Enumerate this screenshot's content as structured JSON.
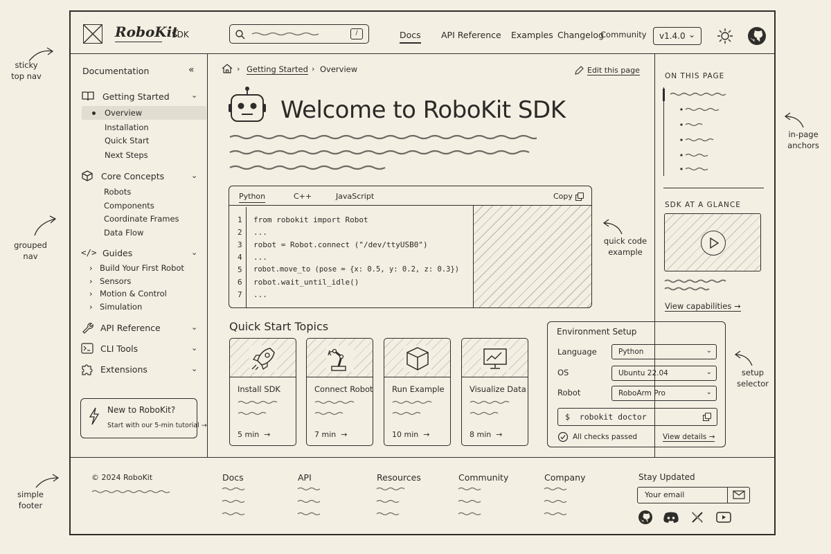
{
  "annotations": {
    "sticky_nav": "sticky\ntop nav",
    "grouped_nav": "grouped\nnav",
    "simple_footer": "simple\nfooter",
    "in_page_anchors": "in-page\nanchors",
    "quick_code_example": "quick code\nexample",
    "setup_selector": "setup\nselector"
  },
  "header": {
    "brand": "RoboKit",
    "brand_tag": "SDK",
    "search_shortcut": "/",
    "nav": [
      "Docs",
      "API Reference",
      "Examples",
      "Changelog",
      "Community"
    ],
    "version": "v1.4.0",
    "version_chevron": "⌄"
  },
  "sidebar": {
    "title": "Documentation",
    "collapse": "«",
    "sections": [
      {
        "label": "Getting Started",
        "icon": "book-icon",
        "items": [
          "Overview",
          "Installation",
          "Quick Start",
          "Next Steps"
        ]
      },
      {
        "label": "Core Concepts",
        "icon": "cube-icon",
        "items": [
          "Robots",
          "Components",
          "Coordinate Frames",
          "Data Flow"
        ]
      },
      {
        "label": "Guides",
        "icon": "code-icon",
        "items": [
          "Build Your First Robot",
          "Sensors",
          "Motion & Control",
          "Simulation"
        ]
      },
      {
        "label": "API Reference",
        "icon": "wrench-icon",
        "items": []
      },
      {
        "label": "CLI Tools",
        "icon": "terminal-icon",
        "items": []
      },
      {
        "label": "Extensions",
        "icon": "puzzle-icon",
        "items": []
      }
    ],
    "promo": {
      "title": "New to RoboKit?",
      "subtitle": "Start with our 5-min tutorial →"
    }
  },
  "breadcrumb": [
    "Getting Started",
    "Overview"
  ],
  "edit_link": "Edit this page",
  "page_title": "Welcome to RoboKit SDK",
  "code": {
    "tabs": [
      "Python",
      "C++",
      "JavaScript"
    ],
    "copy": "Copy",
    "lines": [
      "from robokit import Robot",
      "...",
      "robot = Robot.connect (\"/dev/ttyUSB0\")",
      "...",
      "robot.move_to (pose = {x: 0.5, y: 0.2, z: 0.3})",
      "robot.wait_until_idle()",
      "..."
    ],
    "line_numbers": [
      "1",
      "2",
      "3",
      "4",
      "5",
      "6",
      "7"
    ]
  },
  "quick_start": {
    "title": "Quick Start Topics",
    "cards": [
      {
        "title": "Install SDK",
        "time": "5 min",
        "arrow": "→",
        "icon": "rocket-icon"
      },
      {
        "title": "Connect Robot",
        "time": "7 min",
        "arrow": "→",
        "icon": "robot-arm-icon"
      },
      {
        "title": "Run Example",
        "time": "10 min",
        "arrow": "→",
        "icon": "box-icon"
      },
      {
        "title": "Visualize Data",
        "time": "8 min",
        "arrow": "→",
        "icon": "chart-monitor-icon"
      }
    ]
  },
  "env": {
    "title": "Environment Setup",
    "rows": [
      {
        "label": "Language",
        "value": "Python"
      },
      {
        "label": "OS",
        "value": "Ubuntu 22.04"
      },
      {
        "label": "Robot",
        "value": "RoboArm Pro"
      }
    ],
    "command_prompt": "$",
    "command": "robokit doctor",
    "status": "All checks passed",
    "details_link": "View details →"
  },
  "toc": {
    "title": "ON THIS PAGE",
    "glance_title": "SDK AT A GLANCE",
    "capabilities_link": "View capabilities →"
  },
  "footer": {
    "copyright": "© 2024 RoboKit",
    "columns": [
      "Docs",
      "API",
      "Resources",
      "Community",
      "Company"
    ],
    "newsletter_title": "Stay Updated",
    "email_placeholder": "Your email"
  }
}
